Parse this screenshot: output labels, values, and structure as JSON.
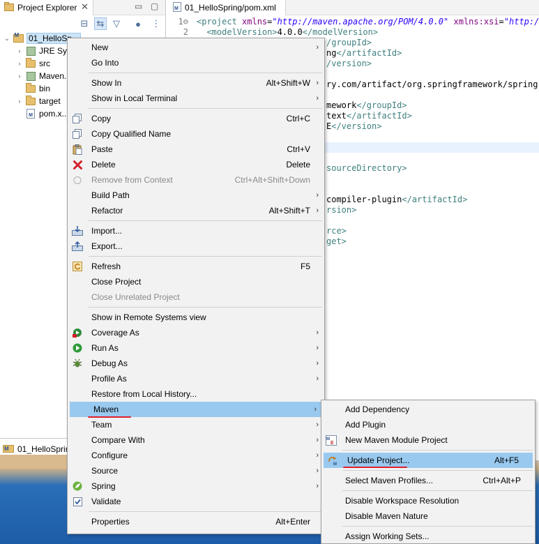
{
  "explorer": {
    "tab_label": "Project Explorer",
    "close_glyph": "✕",
    "tree": [
      {
        "label": "01_HelloSp...",
        "icon": "maven-project-icon",
        "expand": "⌄",
        "indent": 0,
        "selected": true
      },
      {
        "label": "JRE Sy...",
        "icon": "library-icon",
        "expand": "›",
        "indent": 1
      },
      {
        "label": "src",
        "icon": "folder-icon",
        "expand": "›",
        "indent": 1
      },
      {
        "label": "Maven...",
        "icon": "library-icon",
        "expand": "›",
        "indent": 1
      },
      {
        "label": "bin",
        "icon": "folder-icon",
        "expand": "",
        "indent": 1
      },
      {
        "label": "target",
        "icon": "folder-icon",
        "expand": "›",
        "indent": 1
      },
      {
        "label": "pom.x...",
        "icon": "xml-file-icon",
        "expand": "",
        "indent": 1
      }
    ],
    "bottom_label": "01_HelloSprin..."
  },
  "editor": {
    "tab_label": "01_HelloSpring/pom.xml",
    "lines": [
      {
        "num": "1⊖",
        "parts": [
          [
            "tag",
            "<project "
          ],
          [
            "attr",
            "xmlns"
          ],
          [
            "txt",
            "="
          ],
          [
            "str",
            "\"http://maven.apache.org/POM/4.0.0\""
          ],
          [
            "txt",
            " "
          ],
          [
            "attr",
            "xmlns:xsi"
          ],
          [
            "txt",
            "="
          ],
          [
            "str",
            "\"http://w"
          ]
        ]
      },
      {
        "num": "2",
        "parts": [
          [
            "txt",
            "  "
          ],
          [
            "tag",
            "<modelVersion>"
          ],
          [
            "txt",
            "4.0.0"
          ],
          [
            "tag",
            "</modelVersion>"
          ]
        ]
      },
      {
        "num": "",
        "right": [
          [
            "tag",
            "/groupId>"
          ]
        ]
      },
      {
        "num": "",
        "right": [
          [
            "txt",
            "ng"
          ],
          [
            "tag",
            "</artifactId>"
          ]
        ]
      },
      {
        "num": "",
        "right": [
          [
            "tag",
            "/version>"
          ]
        ]
      },
      {
        "num": "",
        "right": []
      },
      {
        "num": "",
        "right": [
          [
            "txt",
            "ry.com/artifact/org.springframework/spring-co"
          ]
        ]
      },
      {
        "num": "",
        "right": []
      },
      {
        "num": "",
        "right": [
          [
            "txt",
            "mework"
          ],
          [
            "tag",
            "</groupId>"
          ]
        ]
      },
      {
        "num": "",
        "right": [
          [
            "txt",
            "text"
          ],
          [
            "tag",
            "</artifactId>"
          ]
        ]
      },
      {
        "num": "",
        "right": [
          [
            "txt",
            "E"
          ],
          [
            "tag",
            "</version>"
          ]
        ]
      },
      {
        "num": "",
        "right": []
      },
      {
        "num": "",
        "right": [],
        "hl": true
      },
      {
        "num": "",
        "right": []
      },
      {
        "num": "",
        "right": [
          [
            "tag",
            "sourceDirectory>"
          ]
        ]
      },
      {
        "num": "",
        "right": []
      },
      {
        "num": "",
        "right": []
      },
      {
        "num": "",
        "right": [
          [
            "txt",
            "compiler-plugin"
          ],
          [
            "tag",
            "</artifactId>"
          ]
        ]
      },
      {
        "num": "",
        "right": [
          [
            "tag",
            "rsion>"
          ]
        ]
      },
      {
        "num": "",
        "right": []
      },
      {
        "num": "",
        "right": [
          [
            "tag",
            "rce>"
          ]
        ]
      },
      {
        "num": "",
        "right": [
          [
            "tag",
            "get>"
          ]
        ]
      }
    ]
  },
  "context_menu": {
    "items": [
      {
        "label": "New",
        "arrow": true
      },
      {
        "label": "Go Into"
      },
      {
        "sep": true
      },
      {
        "label": "Show In",
        "key": "Alt+Shift+W",
        "arrow": true
      },
      {
        "label": "Show in Local Terminal",
        "arrow": true
      },
      {
        "sep": true
      },
      {
        "label": "Copy",
        "key": "Ctrl+C",
        "icon": "copy-icon"
      },
      {
        "label": "Copy Qualified Name",
        "icon": "copy-icon"
      },
      {
        "label": "Paste",
        "key": "Ctrl+V",
        "icon": "paste-icon"
      },
      {
        "label": "Delete",
        "key": "Delete",
        "icon": "delete-icon"
      },
      {
        "label": "Remove from Context",
        "key": "Ctrl+Alt+Shift+Down",
        "icon": "remove-context-icon",
        "disabled": true
      },
      {
        "label": "Build Path",
        "arrow": true
      },
      {
        "label": "Refactor",
        "key": "Alt+Shift+T",
        "arrow": true
      },
      {
        "sep": true
      },
      {
        "label": "Import...",
        "icon": "import-icon"
      },
      {
        "label": "Export...",
        "icon": "export-icon"
      },
      {
        "sep": true
      },
      {
        "label": "Refresh",
        "key": "F5",
        "icon": "refresh-icon"
      },
      {
        "label": "Close Project"
      },
      {
        "label": "Close Unrelated Project",
        "disabled": true
      },
      {
        "sep": true
      },
      {
        "label": "Show in Remote Systems view"
      },
      {
        "label": "Coverage As",
        "arrow": true,
        "icon": "coverage-icon"
      },
      {
        "label": "Run As",
        "arrow": true,
        "icon": "run-icon"
      },
      {
        "label": "Debug As",
        "arrow": true,
        "icon": "debug-icon"
      },
      {
        "label": "Profile As",
        "arrow": true
      },
      {
        "label": "Restore from Local History..."
      },
      {
        "label": "Maven",
        "arrow": true,
        "hover": true
      },
      {
        "label": "Team",
        "arrow": true
      },
      {
        "label": "Compare With",
        "arrow": true
      },
      {
        "label": "Configure",
        "arrow": true
      },
      {
        "label": "Source",
        "arrow": true
      },
      {
        "label": "Spring",
        "arrow": true,
        "icon": "spring-icon"
      },
      {
        "label": "Validate",
        "icon": "validate-icon"
      },
      {
        "sep": true
      },
      {
        "label": "Properties",
        "key": "Alt+Enter"
      }
    ]
  },
  "submenu": {
    "items": [
      {
        "label": "Add Dependency"
      },
      {
        "label": "Add Plugin"
      },
      {
        "label": "New Maven Module Project",
        "icon": "maven-module-icon"
      },
      {
        "sep": true
      },
      {
        "label": "Update Project...",
        "key": "Alt+F5",
        "icon": "maven-update-icon",
        "hover": true
      },
      {
        "sep": true
      },
      {
        "label": "Select Maven Profiles...",
        "key": "Ctrl+Alt+P"
      },
      {
        "sep": true
      },
      {
        "label": "Disable Workspace Resolution"
      },
      {
        "label": "Disable Maven Nature"
      },
      {
        "sep": true
      },
      {
        "label": "Assign Working Sets..."
      }
    ]
  },
  "colors": {
    "menu_hover": "#99c9ef",
    "annotation_underline": "#e0202a"
  }
}
